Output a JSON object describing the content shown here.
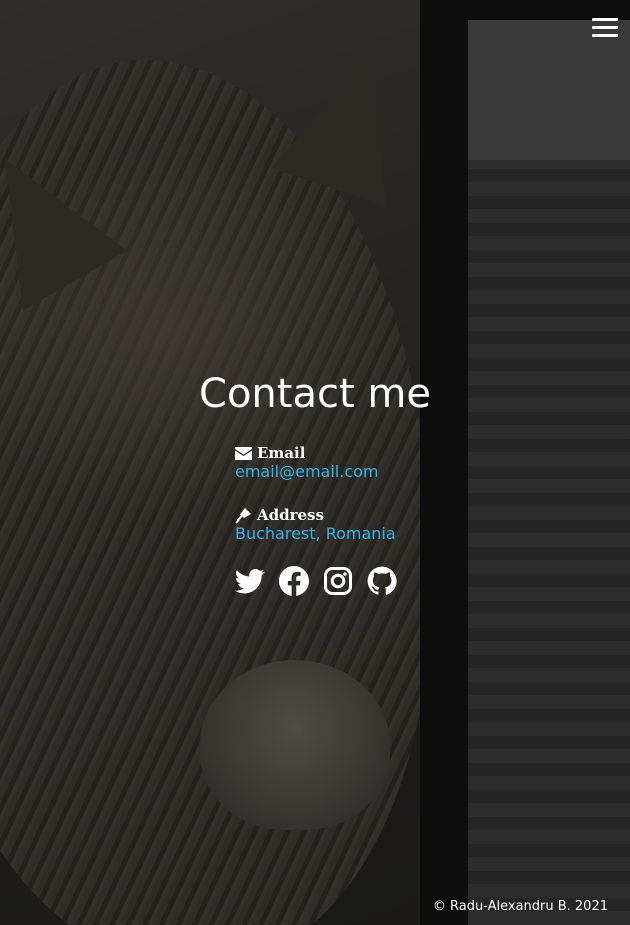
{
  "contact": {
    "title": "Contact me",
    "email": {
      "label": "Email",
      "value": "email@email.com"
    },
    "address": {
      "label": "Address",
      "value": "Bucharest, Romania"
    }
  },
  "socials": [
    {
      "icon": "twitter-icon"
    },
    {
      "icon": "facebook-icon"
    },
    {
      "icon": "instagram-icon"
    },
    {
      "icon": "github-icon"
    }
  ],
  "footer": {
    "copyright": "© Radu-Alexandru B. 2021"
  },
  "colors": {
    "link": "#33b5e5",
    "text": "#ffffff"
  }
}
